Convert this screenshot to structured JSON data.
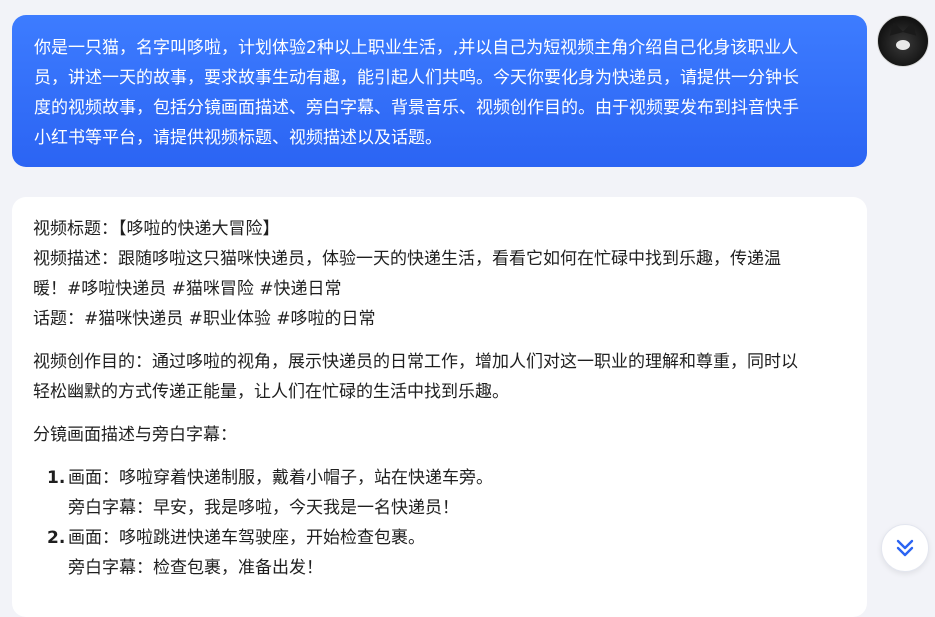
{
  "user_message": {
    "lines": [
      "你是一只猫，名字叫哆啦，计划体验2种以上职业生活，,并以自己为短视频主角介绍自己化身该职业人",
      "员，讲述一天的故事，要求故事生动有趣，能引起人们共鸣。今天你要化身为快递员，请提供一分钟长",
      "度的视频故事，包括分镜画面描述、旁白字幕、背景音乐、视频创作目的。由于视频要发布到抖音快手",
      "小红书等平台，请提供视频标题、视频描述以及话题。"
    ]
  },
  "user_avatar": {
    "icon": "cat-avatar-icon",
    "color": "#141414"
  },
  "response": {
    "title_line": "视频标题：【哆啦的快递大冒险】",
    "description_lines": [
      "视频描述：跟随哆啦这只猫咪快递员，体验一天的快递生活，看看它如何在忙碌中找到乐趣，传递温",
      "暖！#哆啦快递员 #猫咪冒险 #快递日常"
    ],
    "topics_line": "话题：#猫咪快递员 #职业体验 #哆啦的日常",
    "purpose_lines": [
      "视频创作目的：通过哆啦的视角，展示快递员的日常工作，增加人们对这一职业的理解和尊重，同时以",
      "轻松幽默的方式传递正能量，让人们在忙碌的生活中找到乐趣。"
    ],
    "storyboard_heading": "分镜画面描述与旁白字幕：",
    "steps": [
      {
        "num": "1.",
        "scene": "画面：哆啦穿着快递制服，戴着小帽子，站在快递车旁。",
        "narration": "旁白字幕：早安，我是哆啦，今天我是一名快递员！"
      },
      {
        "num": "2.",
        "scene": "画面：哆啦跳进快递车驾驶座，开始检查包裹。",
        "narration": "旁白字幕：检查包裹，准备出发！"
      }
    ]
  },
  "scroll_button": {
    "icon": "double-chevron-down-icon",
    "color": "#2b64f3"
  }
}
